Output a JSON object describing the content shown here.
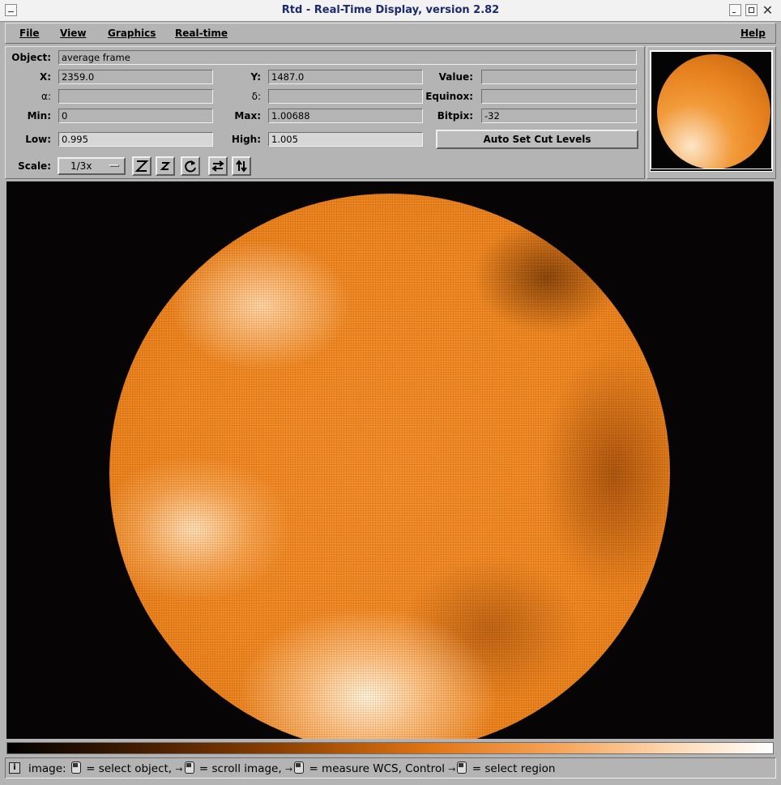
{
  "window": {
    "title": "Rtd - Real-Time Display, version 2.82"
  },
  "menu": {
    "file": "File",
    "view": "View",
    "graphics": "Graphics",
    "realtime": "Real-time",
    "help": "Help"
  },
  "info": {
    "object_label": "Object:",
    "object_value": "average frame",
    "x_label": "X:",
    "x_value": "2359.0",
    "y_label": "Y:",
    "y_value": "1487.0",
    "value_label": "Value:",
    "value_value": "",
    "alpha_label": "α:",
    "alpha_value": "",
    "delta_label": "δ:",
    "delta_value": "",
    "equinox_label": "Equinox:",
    "equinox_value": "",
    "min_label": "Min:",
    "min_value": "0",
    "max_label": "Max:",
    "max_value": "1.00688",
    "bitpix_label": "Bitpix:",
    "bitpix_value": "-32",
    "low_label": "Low:",
    "low_value": "0.995",
    "high_label": "High:",
    "high_value": "1.005",
    "auto_cut_label": "Auto Set Cut Levels",
    "scale_label": "Scale:",
    "scale_value": "1/3x"
  },
  "toolbar_icons": [
    "zoom-in-icon",
    "zoom-out-icon",
    "rotate-icon",
    "flip-x-icon",
    "flip-y-icon"
  ],
  "status": {
    "prefix": "image:",
    "part1": "= select object,",
    "part2": "= scroll image,",
    "part3": "= measure WCS, Control",
    "part4": "= select region"
  },
  "colors": {
    "colormap": [
      "#000000",
      "#8a3f00",
      "#e07414",
      "#fcd9b3",
      "#ffffff"
    ],
    "title_text": "#1c2a6e"
  }
}
